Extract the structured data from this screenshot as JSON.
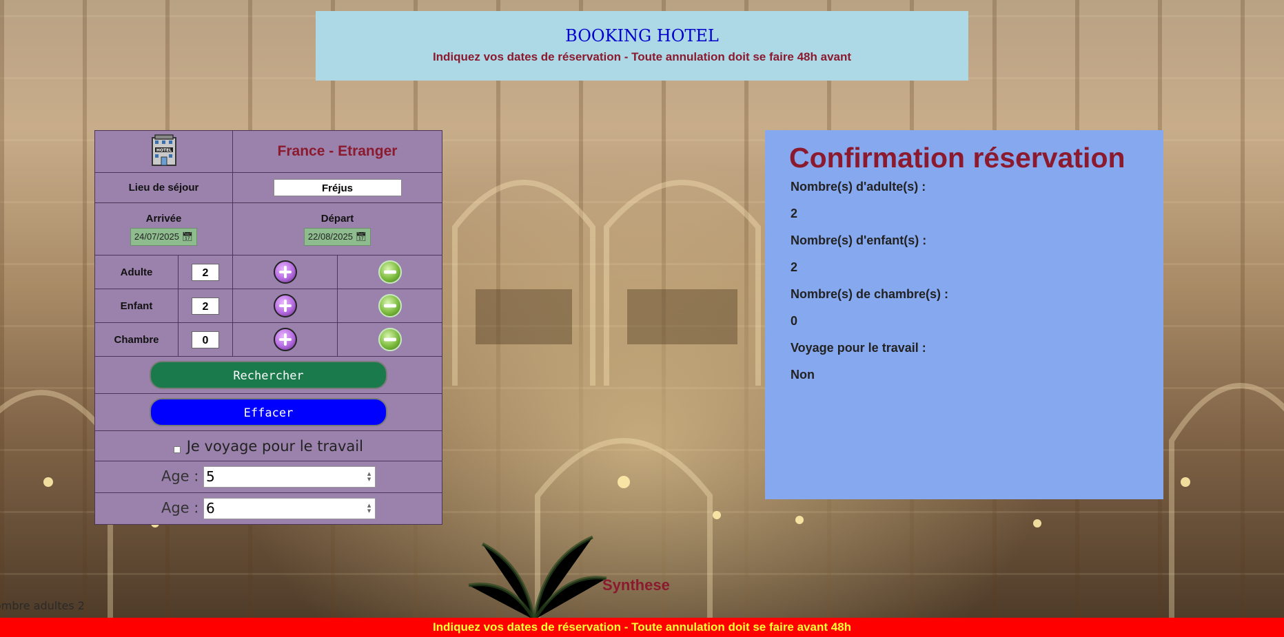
{
  "header": {
    "title": "BOOKING HOTEL",
    "subtitle": "Indiquez vos dates de réservation - Toute annulation doit se faire 48h avant"
  },
  "form": {
    "hotel_icon": "hotel-building-icon",
    "title": "France - Etranger",
    "location_label": "Lieu de séjour",
    "location_value": "Fréjus",
    "arrival_label": "Arrivée",
    "arrival_value": "24/07/2025",
    "departure_label": "Départ",
    "departure_value": "22/08/2025",
    "adult_label": "Adulte",
    "adult_value": "2",
    "child_label": "Enfant",
    "child_value": "2",
    "room_label": "Chambre",
    "room_value": "0",
    "search_button": "Rechercher",
    "clear_button": "Effacer",
    "work_travel_label": "Je voyage pour le travail",
    "work_travel_checked": false,
    "ages": [
      {
        "label": "Age :",
        "value": "5"
      },
      {
        "label": "Age :",
        "value": "6"
      }
    ]
  },
  "confirmation": {
    "title": "Confirmation réservation",
    "adults_label": "Nombre(s) d'adulte(s) :",
    "adults_value": "2",
    "children_label": "Nombre(s) d'enfant(s) :",
    "children_value": "2",
    "rooms_label": "Nombre(s) de chambre(s) :",
    "rooms_value": "0",
    "work_label": "Voyage pour le travail :",
    "work_value": "Non"
  },
  "synthese_label": "Synthese",
  "debug_text": "ombre adultes 2",
  "footer": {
    "text": "Indiquez vos dates de réservation - Toute annulation doit se faire avant 48h"
  },
  "colors": {
    "header_bg": "#add8e6",
    "form_bg": "#9b82ac",
    "confirm_bg": "#86a8ef",
    "accent_red": "#8b1a2e",
    "footer_bg": "#ff0000",
    "footer_text": "#ffff33",
    "search_btn": "#1a7a4c",
    "clear_btn": "#0000ff"
  }
}
